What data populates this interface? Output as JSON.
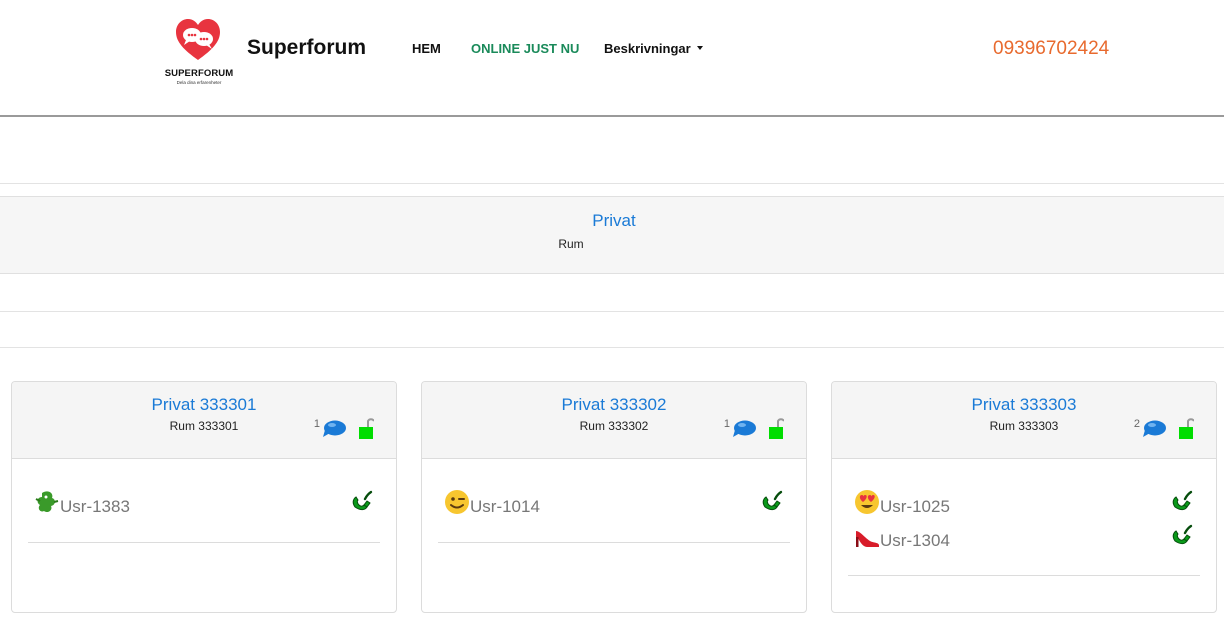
{
  "site": {
    "logo_text": "SUPERFORUM",
    "logo_tagline": "Dela dina erfarenheter",
    "brand": "Superforum",
    "phone": "09396702424"
  },
  "nav": {
    "home": "HEM",
    "online": "ONLINE JUST NU",
    "descriptions": "Beskrivningar"
  },
  "section": {
    "title": "Privat",
    "subtitle": "Rum"
  },
  "colors": {
    "accent_blue": "#1a7ad6",
    "online_green": "#1a8a5a",
    "phone_orange": "#e86a2e",
    "lock_green": "#00dd00"
  },
  "rooms": [
    {
      "title": "Privat 333301",
      "subtitle": "Rum 333301",
      "message_count": "1",
      "users": [
        {
          "name": "Usr-1383",
          "avatar": "dragon-icon"
        }
      ]
    },
    {
      "title": "Privat 333302",
      "subtitle": "Rum 333302",
      "message_count": "1",
      "users": [
        {
          "name": "Usr-1014",
          "avatar": "winking-face-icon"
        }
      ]
    },
    {
      "title": "Privat 333303",
      "subtitle": "Rum 333303",
      "message_count": "2",
      "users": [
        {
          "name": "Usr-1025",
          "avatar": "heart-eyes-face-icon"
        },
        {
          "name": "Usr-1304",
          "avatar": "high-heel-icon"
        }
      ]
    }
  ]
}
